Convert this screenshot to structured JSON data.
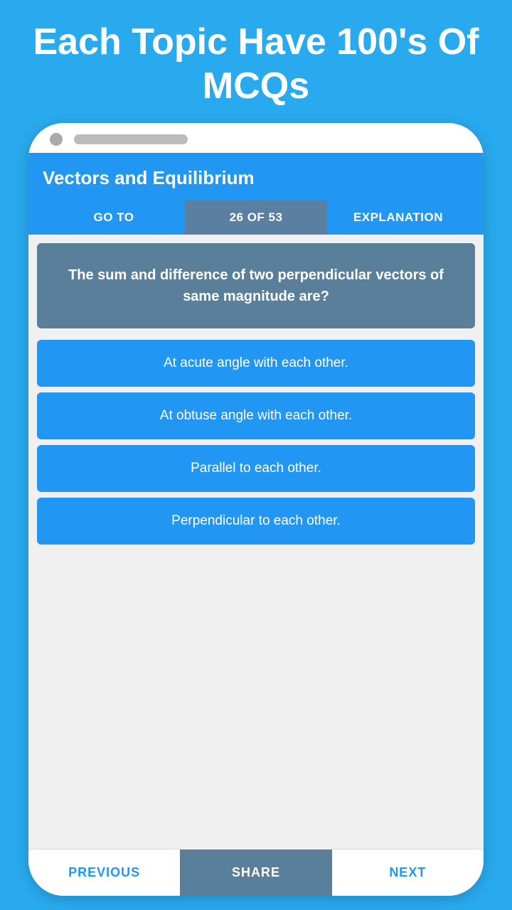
{
  "page": {
    "headline": "Each Topic Have 100's Of MCQs"
  },
  "topic": {
    "title": "Vectors and Equilibrium"
  },
  "tabs": [
    {
      "id": "goto",
      "label": "GO TO",
      "active": false
    },
    {
      "id": "progress",
      "label": "26 OF 53",
      "active": true
    },
    {
      "id": "explanation",
      "label": "EXPLANATION",
      "active": false
    }
  ],
  "question": {
    "text": "The sum and difference of two perpendicular vectors of same magnitude are?"
  },
  "options": [
    {
      "id": "a",
      "text": "At acute angle with each other."
    },
    {
      "id": "b",
      "text": "At obtuse angle with each other."
    },
    {
      "id": "c",
      "text": "Parallel to each other."
    },
    {
      "id": "d",
      "text": "Perpendicular to each other."
    }
  ],
  "bottom_nav": {
    "previous": "PREVIOUS",
    "share": "SHARE",
    "next": "NEXT"
  }
}
